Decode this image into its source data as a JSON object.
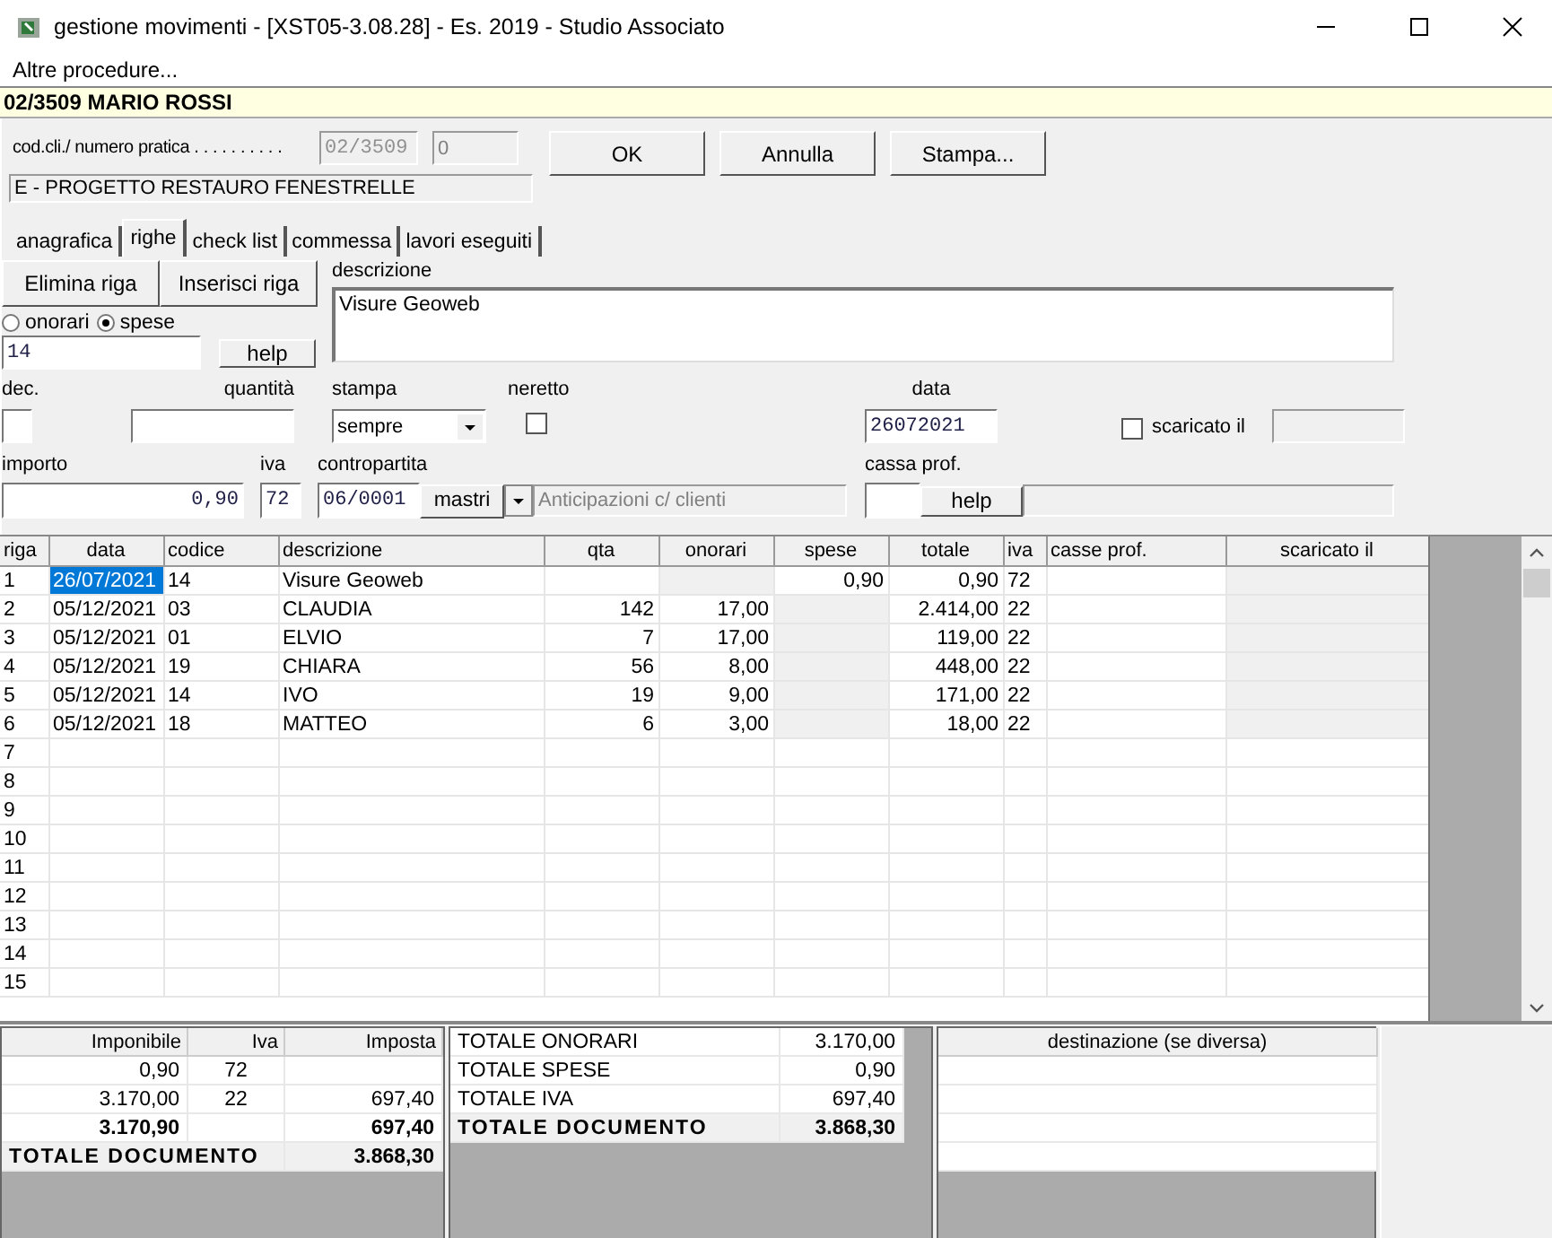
{
  "window": {
    "title": "gestione movimenti - [XST05-3.08.28] - Es. 2019 - Studio Associato"
  },
  "menu": [
    "Altre procedure..."
  ],
  "header": {
    "title": "02/3509 MARIO ROSSI"
  },
  "practice": {
    "label": "cod.cli./ numero pratica . . . . . . . . . .",
    "code": "02/3509",
    "number": "0",
    "description": "E - PROGETTO RESTAURO FENESTRELLE"
  },
  "buttons": [
    "OK",
    "Annulla",
    "Stampa..."
  ],
  "tabs": [
    {
      "label": "anagrafica",
      "selected": false
    },
    {
      "label": "righe",
      "selected": true
    },
    {
      "label": "check list",
      "selected": false
    },
    {
      "label": "commessa",
      "selected": false
    },
    {
      "label": "lavori eseguiti",
      "selected": false
    }
  ],
  "form": {
    "row_buttons": [
      "Elimina riga",
      "Inserisci riga"
    ],
    "radios": [
      {
        "label": "onorari",
        "selected": false
      },
      {
        "label": "spese",
        "selected": true
      }
    ],
    "code": "14",
    "help": "help",
    "description_label": "descrizione",
    "description": "Visure Geoweb",
    "dec_label": "dec.",
    "quantity_label": "quantità",
    "print_label": "stampa",
    "print_value": "sempre",
    "bold_label": "neretto",
    "bold_checked": false,
    "date_label": "data",
    "date": "26072021",
    "downloaded_label": "scaricato il",
    "downloaded_checked": false,
    "amount_label": "importo",
    "amount": "0,90",
    "vat_label": "iva",
    "vat": "72",
    "account_label": "contropartita",
    "account": "06/0001",
    "account_type": "mastri",
    "account_name": "Anticipazioni c/ clienti",
    "fund_label": "cassa prof.",
    "fund_help": "help"
  },
  "table": {
    "columns": [
      "riga",
      "data",
      "codice",
      "descrizione",
      "qta",
      "onorari",
      "spese",
      "totale",
      "iva",
      "casse prof.",
      "scaricato il"
    ],
    "rows": [
      {
        "riga": "1",
        "data": "26/07/2021",
        "codice": "14",
        "descrizione": "Visure Geoweb",
        "spese": "0,90",
        "totale": "0,90",
        "iva": "72",
        "kind": "spese",
        "selected": true
      },
      {
        "riga": "2",
        "data": "05/12/2021",
        "codice": "03",
        "descrizione": "CLAUDIA",
        "qta": "142",
        "onorari": "17,00",
        "totale": "2.414,00",
        "iva": "22",
        "kind": "onorari",
        "selected": false
      },
      {
        "riga": "3",
        "data": "05/12/2021",
        "codice": "01",
        "descrizione": "ELVIO",
        "qta": "7",
        "onorari": "17,00",
        "totale": "119,00",
        "iva": "22",
        "kind": "onorari",
        "selected": false
      },
      {
        "riga": "4",
        "data": "05/12/2021",
        "codice": "19",
        "descrizione": "CHIARA",
        "qta": "56",
        "onorari": "8,00",
        "totale": "448,00",
        "iva": "22",
        "kind": "onorari",
        "selected": false
      },
      {
        "riga": "5",
        "data": "05/12/2021",
        "codice": "14",
        "descrizione": "IVO",
        "qta": "19",
        "onorari": "9,00",
        "totale": "171,00",
        "iva": "22",
        "kind": "onorari",
        "selected": false
      },
      {
        "riga": "6",
        "data": "05/12/2021",
        "codice": "18",
        "descrizione": "MATTEO",
        "qta": "6",
        "onorari": "3,00",
        "totale": "18,00",
        "iva": "22",
        "kind": "onorari",
        "selected": false
      }
    ],
    "empty_rows": [
      "7",
      "8",
      "9",
      "10",
      "11",
      "12",
      "13",
      "14",
      "15"
    ]
  },
  "vat_summary": {
    "columns": [
      "Imponibile",
      "Iva",
      "Imposta"
    ],
    "rows": [
      {
        "imponibile": "0,90",
        "iva": "72"
      },
      {
        "imponibile": "3.170,00",
        "iva": "22",
        "imposta": "697,40"
      }
    ],
    "total": {
      "imponibile": "3.170,90",
      "imposta": "697,40"
    },
    "grand_total": {
      "label": "TOTALE DOCUMENTO",
      "value": "3.868,30"
    }
  },
  "totals": [
    {
      "label": "TOTALE ONORARI",
      "value": "3.170,00",
      "bold": false
    },
    {
      "label": "TOTALE SPESE",
      "value": "0,90",
      "bold": false
    },
    {
      "label": "TOTALE IVA",
      "value": "697,40",
      "bold": false
    },
    {
      "label": "TOTALE DOCUMENTO",
      "value": "3.868,30",
      "bold": true
    }
  ],
  "destination": {
    "header": "destinazione (se diversa)"
  }
}
